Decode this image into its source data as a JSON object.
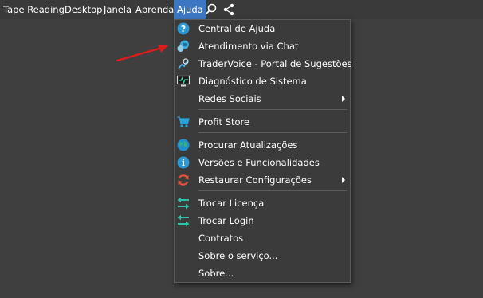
{
  "menubar": {
    "items": [
      {
        "label": "Tape Reading"
      },
      {
        "label": "Desktop"
      },
      {
        "label": "Janela"
      },
      {
        "label": "Aprenda"
      },
      {
        "label": "Ajuda"
      }
    ],
    "active_color": "#3d77c4"
  },
  "dropdown": {
    "items": [
      {
        "label": "Central de Ajuda",
        "icon": "help-circle-icon"
      },
      {
        "label": "Atendimento via Chat",
        "icon": "chat-support-icon"
      },
      {
        "label": "TraderVoice - Portal de Sugestões",
        "icon": "tradervoice-icon"
      },
      {
        "label": "Diagnóstico de Sistema",
        "icon": "monitor-diagnostic-icon"
      },
      {
        "label": "Redes Sociais",
        "icon": "",
        "submenu": true
      },
      {
        "label": "Profit Store",
        "icon": "shopping-cart-icon"
      },
      {
        "label": "Procurar Atualizações",
        "icon": "globe-icon"
      },
      {
        "label": "Versões e Funcionalidades",
        "icon": "info-icon"
      },
      {
        "label": "Restaurar Configurações",
        "icon": "restore-icon",
        "submenu": true
      },
      {
        "label": "Trocar Licença",
        "icon": "swap-arrows-icon"
      },
      {
        "label": "Trocar Login",
        "icon": "swap-arrows-icon"
      },
      {
        "label": "Contratos",
        "icon": ""
      },
      {
        "label": "Sobre o serviço...",
        "icon": ""
      },
      {
        "label": "Sobre...",
        "icon": ""
      }
    ]
  },
  "colors": {
    "background": "#3f3f3f",
    "menu_bg": "#3b3b3b",
    "annotation": "#e01b1b",
    "accent": "#3d77c4"
  }
}
